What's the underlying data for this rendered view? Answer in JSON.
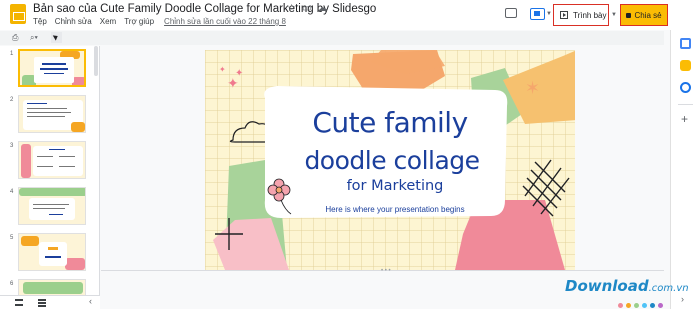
{
  "header": {
    "title": "Bản sao của Cute Family Doodle Collage for Marketing by Slidesgo",
    "menu": [
      "Tệp",
      "Chỉnh sửa",
      "Xem",
      "Trợ giúp"
    ],
    "last_edit": "Chỉnh sửa lần cuối vào 22 tháng 8",
    "present_label": "Trình bày",
    "share_label": "Chia sẻ"
  },
  "toolbar": {
    "icons": [
      "print-icon",
      "zoom-icon",
      "select-cursor-icon"
    ]
  },
  "filmstrip": {
    "slides": [
      "1",
      "2",
      "3",
      "4",
      "5",
      "6"
    ]
  },
  "slide": {
    "title_line1": "Cute family",
    "title_line2": "doodle collage",
    "subtitle": "for Marketing",
    "tagline": "Here is where your presentation begins"
  },
  "watermark": {
    "brand": "Download",
    "domain": ".com.vn"
  },
  "colors": {
    "accent_blue": "#1b3f9c",
    "share_yellow": "#fbbc04",
    "highlight_red": "#d93025",
    "slide_bg": "#fdf5d2"
  }
}
